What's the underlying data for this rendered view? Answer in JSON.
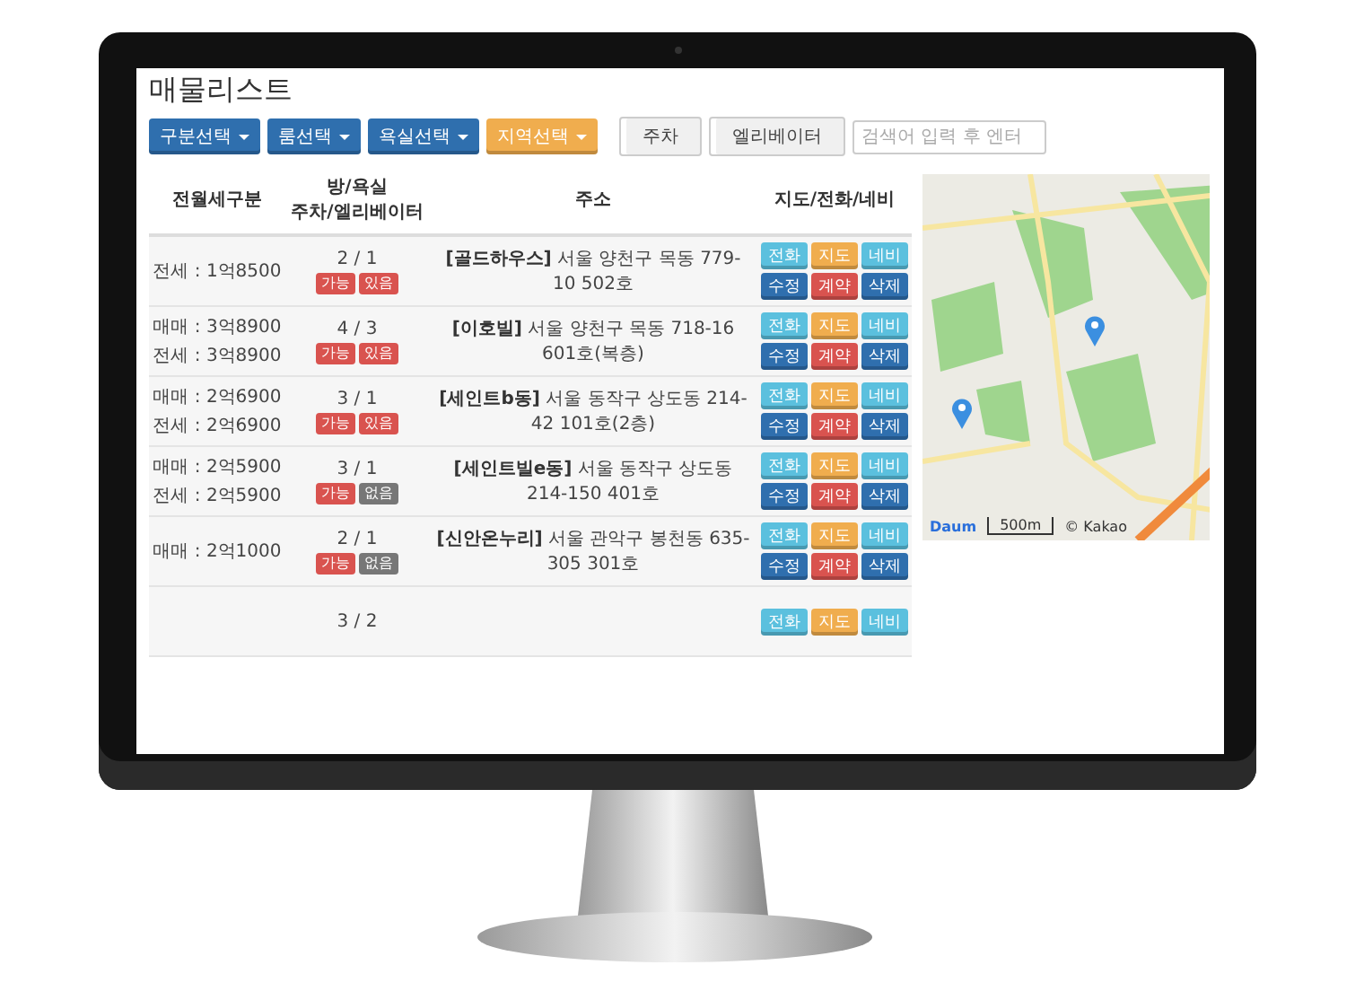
{
  "title": "매물리스트",
  "toolbar": {
    "dropdowns": [
      {
        "label": "구분선택",
        "kind": "primary"
      },
      {
        "label": "룸선택",
        "kind": "primary"
      },
      {
        "label": "욕실선택",
        "kind": "primary"
      },
      {
        "label": "지역선택",
        "kind": "warning"
      }
    ],
    "toggles": [
      {
        "label": "주차",
        "selected": false
      },
      {
        "label": "엘리베이터",
        "selected": false
      }
    ],
    "search": {
      "placeholder": "검색어 입력 후 엔터"
    }
  },
  "table": {
    "columns": [
      {
        "label": "전월세구분"
      },
      {
        "label": "방/욕실",
        "sublabel": "주차/엘리베이터"
      },
      {
        "label": "주소"
      },
      {
        "label": "지도/전화/네비"
      }
    ],
    "rows": [
      {
        "prices": [
          "전세 : 1억8500"
        ],
        "rooms": "2 / 1",
        "badges": [
          {
            "label": "가능",
            "on": true
          },
          {
            "label": "있음",
            "on": true
          }
        ],
        "address": "**[골드하우스]** 서울 양천구 목동 779-10 502호",
        "actions": [
          [
            {
              "label": "전화",
              "kind": "info"
            },
            {
              "label": "지도",
              "kind": "warning"
            },
            {
              "label": "네비",
              "kind": "info"
            }
          ],
          [
            {
              "label": "수정",
              "kind": "primary"
            },
            {
              "label": "계약",
              "kind": "danger"
            },
            {
              "label": "삭제",
              "kind": "primary"
            }
          ]
        ]
      },
      {
        "prices": [
          "매매 : 3억8900",
          "전세 : 3억8900"
        ],
        "rooms": "4 / 3",
        "badges": [
          {
            "label": "가능",
            "on": true
          },
          {
            "label": "있음",
            "on": true
          }
        ],
        "address": "**[이호빌]** 서울 양천구 목동 718-16 601호(복층)",
        "actions": [
          [
            {
              "label": "전화",
              "kind": "info"
            },
            {
              "label": "지도",
              "kind": "warning"
            },
            {
              "label": "네비",
              "kind": "info"
            }
          ],
          [
            {
              "label": "수정",
              "kind": "primary"
            },
            {
              "label": "계약",
              "kind": "danger"
            },
            {
              "label": "삭제",
              "kind": "primary"
            }
          ]
        ]
      },
      {
        "prices": [
          "매매 : 2억6900",
          "전세 : 2억6900"
        ],
        "rooms": "3 / 1",
        "badges": [
          {
            "label": "가능",
            "on": true
          },
          {
            "label": "있음",
            "on": true
          }
        ],
        "address": "**[세인트b동]** 서울 동작구 상도동 214-42 101호(2층)",
        "actions": [
          [
            {
              "label": "전화",
              "kind": "info"
            },
            {
              "label": "지도",
              "kind": "warning"
            },
            {
              "label": "네비",
              "kind": "info"
            }
          ],
          [
            {
              "label": "수정",
              "kind": "primary"
            },
            {
              "label": "계약",
              "kind": "danger"
            },
            {
              "label": "삭제",
              "kind": "primary"
            }
          ]
        ]
      },
      {
        "prices": [
          "매매 : 2억5900",
          "전세 : 2억5900"
        ],
        "rooms": "3 / 1",
        "badges": [
          {
            "label": "가능",
            "on": true
          },
          {
            "label": "없음",
            "on": false
          }
        ],
        "address": "**[세인트빌e동]** 서울 동작구 상도동 214-150 401호",
        "actions": [
          [
            {
              "label": "전화",
              "kind": "info"
            },
            {
              "label": "지도",
              "kind": "warning"
            },
            {
              "label": "네비",
              "kind": "info"
            }
          ],
          [
            {
              "label": "수정",
              "kind": "primary"
            },
            {
              "label": "계약",
              "kind": "danger"
            },
            {
              "label": "삭제",
              "kind": "primary"
            }
          ]
        ]
      },
      {
        "prices": [
          "매매 : 2억1000"
        ],
        "rooms": "2 / 1",
        "badges": [
          {
            "label": "가능",
            "on": true
          },
          {
            "label": "없음",
            "on": false
          }
        ],
        "address": "**[신안온누리]** 서울 관악구 봉천동 635-305 301호",
        "actions": [
          [
            {
              "label": "전화",
              "kind": "info"
            },
            {
              "label": "지도",
              "kind": "warning"
            },
            {
              "label": "네비",
              "kind": "info"
            }
          ],
          [
            {
              "label": "수정",
              "kind": "primary"
            },
            {
              "label": "계약",
              "kind": "danger"
            },
            {
              "label": "삭제",
              "kind": "primary"
            }
          ]
        ]
      },
      {
        "prices": [],
        "rooms": "3 / 2",
        "badges": [],
        "actions": [
          [
            {
              "label": "전화",
              "kind": "info"
            },
            {
              "label": "지도",
              "kind": "warning"
            },
            {
              "label": "네비",
              "kind": "info"
            }
          ]
        ]
      }
    ]
  },
  "map": {
    "logo": "Daum",
    "scale": "500m",
    "attribution": "© Kakao"
  }
}
